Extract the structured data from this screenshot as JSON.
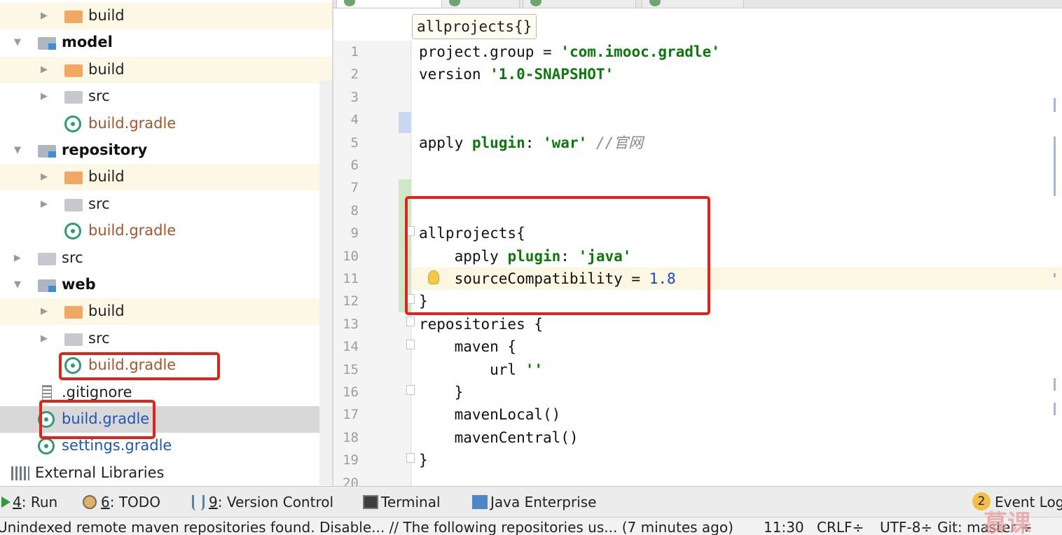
{
  "tree": {
    "items": [
      {
        "label": "build",
        "kind": "folder-orange",
        "depth": 1,
        "expander": "collapsed",
        "style": "normal",
        "highlight": true
      },
      {
        "label": "model",
        "kind": "module",
        "depth": 0,
        "expander": "expanded",
        "style": "bold",
        "highlight": false
      },
      {
        "label": "build",
        "kind": "folder-orange",
        "depth": 1,
        "expander": "collapsed",
        "style": "normal",
        "highlight": true
      },
      {
        "label": "src",
        "kind": "folder-gray",
        "depth": 1,
        "expander": "collapsed",
        "style": "normal",
        "highlight": false
      },
      {
        "label": "build.gradle",
        "kind": "gradle",
        "depth": 1,
        "expander": "none",
        "style": "brown",
        "highlight": false
      },
      {
        "label": "repository",
        "kind": "module",
        "depth": 0,
        "expander": "expanded",
        "style": "bold",
        "highlight": false
      },
      {
        "label": "build",
        "kind": "folder-orange",
        "depth": 1,
        "expander": "collapsed",
        "style": "normal",
        "highlight": true
      },
      {
        "label": "src",
        "kind": "folder-gray",
        "depth": 1,
        "expander": "collapsed",
        "style": "normal",
        "highlight": false
      },
      {
        "label": "build.gradle",
        "kind": "gradle",
        "depth": 1,
        "expander": "none",
        "style": "brown",
        "highlight": false
      },
      {
        "label": "src",
        "kind": "folder-gray",
        "depth": 0,
        "expander": "collapsed",
        "style": "normal",
        "highlight": false
      },
      {
        "label": "web",
        "kind": "module",
        "depth": 0,
        "expander": "expanded",
        "style": "bold",
        "highlight": false
      },
      {
        "label": "build",
        "kind": "folder-orange",
        "depth": 1,
        "expander": "collapsed",
        "style": "normal",
        "highlight": true
      },
      {
        "label": "src",
        "kind": "folder-gray",
        "depth": 1,
        "expander": "collapsed",
        "style": "normal",
        "highlight": false
      },
      {
        "label": "build.gradle",
        "kind": "gradle",
        "depth": 1,
        "expander": "none",
        "style": "brown",
        "highlight": false
      },
      {
        "label": ".gitignore",
        "kind": "file",
        "depth": 0,
        "expander": "none",
        "style": "normal",
        "highlight": false
      },
      {
        "label": "build.gradle",
        "kind": "gradle",
        "depth": 0,
        "expander": "none",
        "style": "blue",
        "highlight": false,
        "selected": true
      },
      {
        "label": "settings.gradle",
        "kind": "gradle",
        "depth": 0,
        "expander": "none",
        "style": "blue",
        "highlight": false
      },
      {
        "label": "External Libraries",
        "kind": "libraries",
        "depth": -1,
        "expander": "none",
        "style": "normal",
        "highlight": false
      }
    ]
  },
  "editor": {
    "breadcrumb": "allprojects{}",
    "lines": [
      {
        "n": "1",
        "tokens": [
          {
            "t": "project.group = ",
            "c": ""
          },
          {
            "t": "'com.imooc.gradle'",
            "c": "str"
          }
        ]
      },
      {
        "n": "2",
        "tokens": [
          {
            "t": "version ",
            "c": ""
          },
          {
            "t": "'1.0-SNAPSHOT'",
            "c": "str"
          }
        ]
      },
      {
        "n": "3",
        "tokens": []
      },
      {
        "n": "4",
        "tokens": []
      },
      {
        "n": "5",
        "tokens": [
          {
            "t": "apply ",
            "c": ""
          },
          {
            "t": "plugin",
            "c": "kw"
          },
          {
            "t": ": ",
            "c": ""
          },
          {
            "t": "'war'",
            "c": "str"
          },
          {
            "t": " //官网",
            "c": "cmt"
          }
        ]
      },
      {
        "n": "6",
        "tokens": []
      },
      {
        "n": "7",
        "tokens": []
      },
      {
        "n": "8",
        "tokens": []
      },
      {
        "n": "9",
        "tokens": [
          {
            "t": "allprojects{",
            "c": ""
          }
        ]
      },
      {
        "n": "10",
        "tokens": [
          {
            "t": "    apply ",
            "c": ""
          },
          {
            "t": "plugin",
            "c": "kw"
          },
          {
            "t": ": ",
            "c": ""
          },
          {
            "t": "'java'",
            "c": "str"
          }
        ]
      },
      {
        "n": "11",
        "tokens": [
          {
            "t": "    sourceCompatibility = ",
            "c": ""
          },
          {
            "t": "1.8",
            "c": "num"
          }
        ]
      },
      {
        "n": "12",
        "tokens": [
          {
            "t": "}",
            "c": ""
          }
        ]
      },
      {
        "n": "13",
        "tokens": [
          {
            "t": "repositories {",
            "c": ""
          }
        ]
      },
      {
        "n": "14",
        "tokens": [
          {
            "t": "    maven {",
            "c": ""
          }
        ]
      },
      {
        "n": "15",
        "tokens": [
          {
            "t": "        url ",
            "c": ""
          },
          {
            "t": "''",
            "c": "str"
          }
        ]
      },
      {
        "n": "16",
        "tokens": [
          {
            "t": "    }",
            "c": ""
          }
        ]
      },
      {
        "n": "17",
        "tokens": [
          {
            "t": "    mavenLocal()",
            "c": ""
          }
        ]
      },
      {
        "n": "18",
        "tokens": [
          {
            "t": "    mavenCentral()",
            "c": ""
          }
        ]
      },
      {
        "n": "19",
        "tokens": [
          {
            "t": "}",
            "c": ""
          }
        ]
      },
      {
        "n": "20",
        "tokens": []
      }
    ]
  },
  "toolwindows": {
    "run": {
      "key": "4",
      "label": ": Run"
    },
    "todo": {
      "key": "6",
      "label": ": TODO"
    },
    "vcs": {
      "key": "9",
      "label": ": Version Control"
    },
    "terminal": {
      "label": "Terminal"
    },
    "javaee": {
      "label": "Java Enterprise"
    },
    "eventlog": {
      "badge": "2",
      "label": "Event Log"
    }
  },
  "status": {
    "message": "Unindexed remote maven repositories found. Disable... // The following repositories us... (7 minutes ago)",
    "position": "11:30",
    "line_sep": "CRLF÷",
    "encoding": "UTF-8÷",
    "vcs": "Git: master ÷"
  },
  "watermark": "慕课"
}
